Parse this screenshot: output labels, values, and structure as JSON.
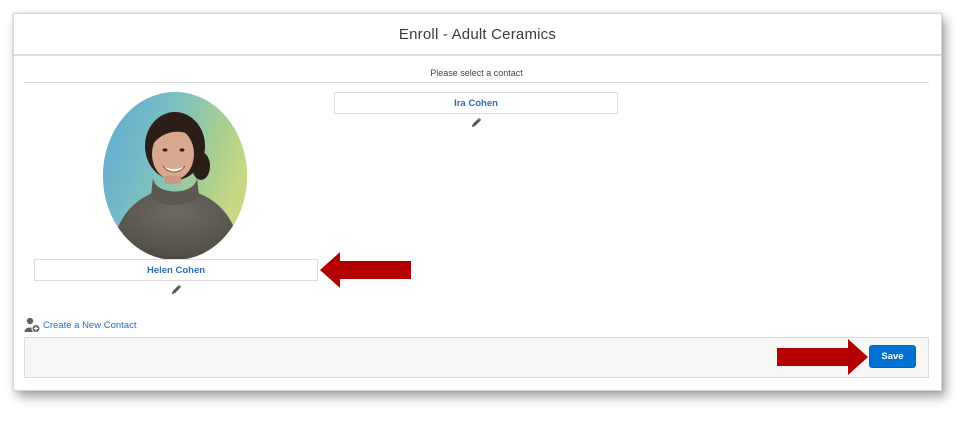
{
  "modal": {
    "title": "Enroll - Adult Ceramics"
  },
  "contact_section": {
    "label": "Please select a contact",
    "contacts": [
      {
        "name": "Ira Cohen",
        "has_photo": false
      },
      {
        "name": "Helen Cohen",
        "has_photo": true
      }
    ]
  },
  "create_contact": {
    "label": "Create a New Contact",
    "icon": "add-contact-icon"
  },
  "footer": {
    "save_label": "Save"
  },
  "icons": {
    "edit": "pencil-icon"
  },
  "colors": {
    "link_blue": "#2a6fb8",
    "button_blue": "#0070d2",
    "annotation_arrow": "#b30000"
  }
}
